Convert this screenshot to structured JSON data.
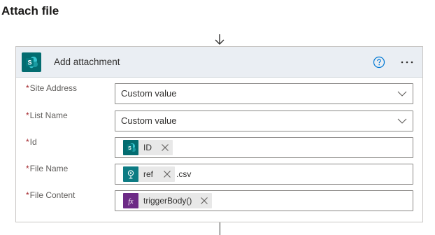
{
  "page": {
    "title": "Attach file"
  },
  "action": {
    "title": "Add attachment",
    "icons": {
      "app": "sharepoint-icon",
      "help": "help-icon",
      "more": "more-options-icon"
    }
  },
  "fields": {
    "site_address": {
      "required": "*",
      "label": "Site Address",
      "value": "Custom value"
    },
    "list_name": {
      "required": "*",
      "label": "List Name",
      "value": "Custom value"
    },
    "id": {
      "required": "*",
      "label": "Id",
      "token": "ID"
    },
    "file_name": {
      "required": "*",
      "label": "File Name",
      "token": "ref",
      "suffix": ".csv"
    },
    "file_content": {
      "required": "*",
      "label": "File Content",
      "token": "triggerBody()"
    }
  },
  "colors": {
    "sharepoint": "#036c70",
    "variable_token": "#0d7b83",
    "expression_token": "#6d2b86",
    "help_blue": "#0078d4",
    "required": "#a4262c"
  }
}
